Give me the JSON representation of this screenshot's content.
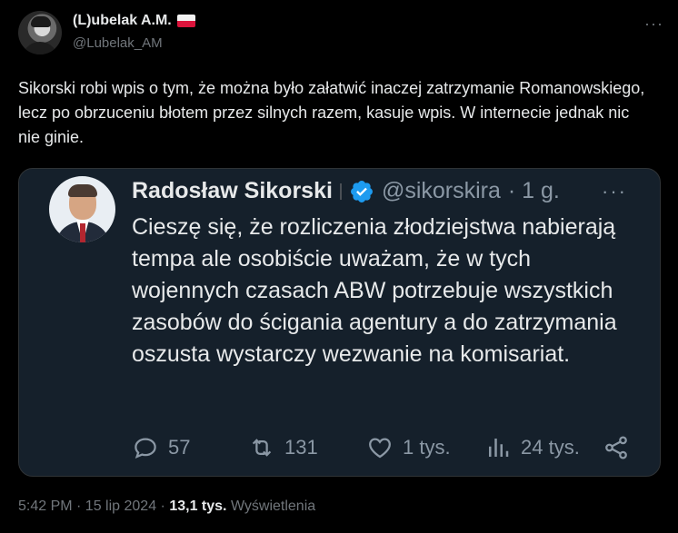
{
  "author": {
    "display_name": "(L)ubelak A.M.",
    "handle": "@Lubelak_AM",
    "flag_icon": "poland-flag-icon"
  },
  "tweet": {
    "text": "Sikorski robi wpis o tym, że można było załatwić inaczej zatrzymanie Romanowskiego, lecz po obrzuceniu błotem przez silnych razem, kasuje wpis. W internecie jednak nic nie ginie."
  },
  "quote": {
    "name": "Radosław Sikorski",
    "handle": "@sikorskira",
    "time": "· 1 g.",
    "text": "Cieszę się, że rozliczenia złodziejstwa nabierają tempa ale osobiście uważam, że w tych wojennych czasach ABW potrzebuje wszystkich zasobów do ścigania agentury a do zatrzymania oszusta wystarczy wezwanie na komisariat.",
    "replies": "57",
    "reposts": "131",
    "likes": "1 tys.",
    "views": "24 tys.",
    "verified_color": "#1d9bf0"
  },
  "footer": {
    "time": "5:42 PM · 15 lip 2024 ·",
    "views_count": "13,1 tys.",
    "views_label": "Wyświetlenia"
  }
}
